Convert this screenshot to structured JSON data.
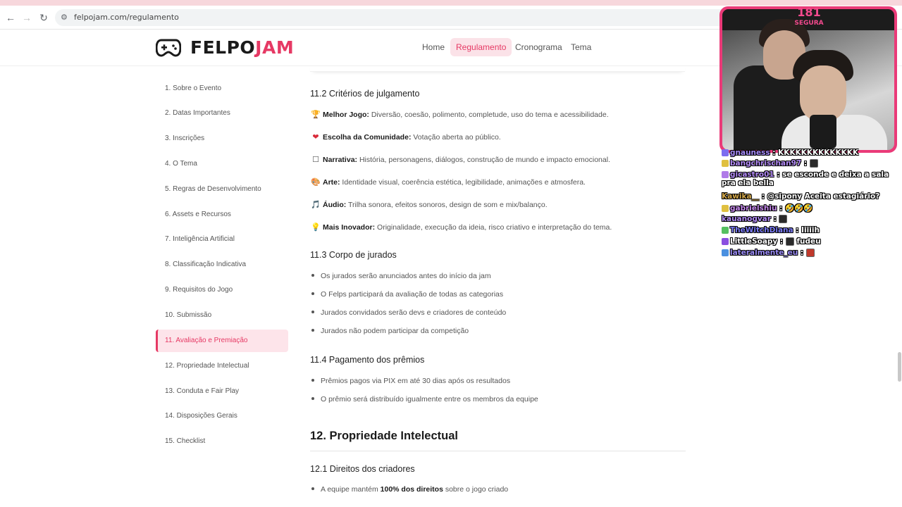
{
  "browser": {
    "url": "felpojam.com/regulamento",
    "back_icon": "←",
    "forward_icon": "→",
    "reload_icon": "↻",
    "site_icon": "⚙"
  },
  "header": {
    "logo_part1": "FELPO",
    "logo_part2": "JAM",
    "nav": [
      "Home",
      "Regulamento",
      "Cronograma",
      "Tema"
    ],
    "active_nav": "Regulamento",
    "accent_color": "#e63964"
  },
  "sidebar": {
    "items": [
      "1. Sobre o Evento",
      "2. Datas Importantes",
      "3. Inscrições",
      "4. O Tema",
      "5. Regras de Desenvolvimento",
      "6. Assets e Recursos",
      "7. Inteligência Artificial",
      "8. Classificação Indicativa",
      "9. Requisitos do Jogo",
      "10. Submissão",
      "11. Avaliação e Premiação",
      "12. Propriedade Intelectual",
      "13. Conduta e Fair Play",
      "14. Disposições Gerais",
      "15. Checklist"
    ],
    "active_item": "11. Avaliação e Premiação"
  },
  "content": {
    "criteria_title": "11.2 Critérios de julgamento",
    "criteria": [
      {
        "icon": "trophy-icon",
        "glyph": "🏆",
        "label": "Melhor Jogo:",
        "text": " Diversão, coesão, polimento, completude, uso do tema e acessibilidade."
      },
      {
        "icon": "heart-icon",
        "glyph": "❤",
        "label": "Escolha da Comunidade:",
        "text": " Votação aberta ao público."
      },
      {
        "icon": "book-icon",
        "glyph": "☐",
        "label": "Narrativa:",
        "text": " História, personagens, diálogos, construção de mundo e impacto emocional."
      },
      {
        "icon": "palette-icon",
        "glyph": "🎨",
        "label": "Arte:",
        "text": " Identidade visual, coerência estética, legibilidade, animações e atmosfera."
      },
      {
        "icon": "music-icon",
        "glyph": "🎵",
        "label": "Áudio:",
        "text": " Trilha sonora, efeitos sonoros, design de som e mix/balanço."
      },
      {
        "icon": "lightbulb-icon",
        "glyph": "💡",
        "label": "Mais Inovador:",
        "text": " Originalidade, execução da ideia, risco criativo e interpretação do tema."
      }
    ],
    "jury_title": "11.3 Corpo de jurados",
    "jury": [
      "Os jurados serão anunciados antes do início da jam",
      "O Felps participará da avaliação de todas as categorias",
      "Jurados convidados serão devs e criadores de conteúdo",
      "Jurados não podem participar da competição"
    ],
    "payment_title": "11.4 Pagamento dos prêmios",
    "payment": [
      "Prêmios pagos via PIX em até 30 dias após os resultados",
      "O prêmio será distribuído igualmente entre os membros da equipe"
    ],
    "section12_title": "12. Propriedade Intelectual",
    "rights_title": "12.1 Direitos dos criadores",
    "rights_prefix": "A equipe mantém ",
    "rights_bold": "100% dos direitos",
    "rights_suffix": " sobre o jogo criado"
  },
  "stream": {
    "viewer_count": "181",
    "viewer_label": "SEGURA",
    "chat": [
      {
        "user": "gnauness",
        "user_color": "#a78bfa",
        "badge_color": "#7c6cf0",
        "message": "KKKKKKKKKKKKKK"
      },
      {
        "user": "bangchrischan97",
        "user_color": "#b48cf7",
        "badge_color": "#e0c040",
        "message": ""
      },
      {
        "user": "gicastro01",
        "user_color": "#b48cf7",
        "badge_color": "#b07be8",
        "message": "se esconde e deixa a sala pra ela bella"
      },
      {
        "user": "Kawika__",
        "user_color": "#d4a84a",
        "badge_color": "",
        "message": "@sipony Aceita estagiário?"
      },
      {
        "user": "gabrielshiu",
        "user_color": "#c98cf0",
        "badge_color": "#e0c040",
        "message": "🤣🤣🤣"
      },
      {
        "user": "kauanogvar",
        "user_color": "#b48cf7",
        "badge_color": "",
        "message": ""
      },
      {
        "user": "TheWitchDiana",
        "user_color": "#7c7cf7",
        "badge_color": "#55c060",
        "message": "Iiiiih"
      },
      {
        "user": "LittleSoapy",
        "user_color": "#ffffff",
        "badge_color": "#8a4fe0",
        "message": "fudeu"
      },
      {
        "user": "lateralmente_eu",
        "user_color": "#9b8cf7",
        "badge_color": "#4a90e0",
        "message": ""
      }
    ]
  }
}
